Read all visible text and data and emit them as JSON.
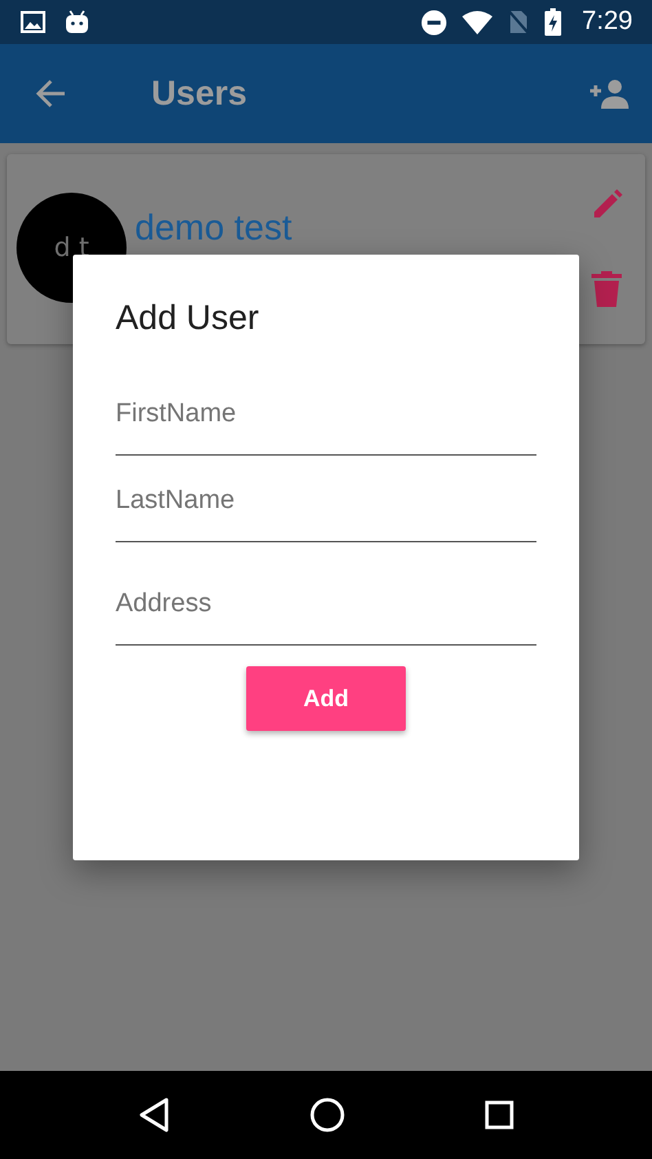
{
  "status_bar": {
    "time": "7:29"
  },
  "app_bar": {
    "title": "Users"
  },
  "users": [
    {
      "initials": "d t",
      "name": "demo test"
    }
  ],
  "dialog": {
    "title": "Add User",
    "fields": [
      {
        "placeholder": "FirstName"
      },
      {
        "placeholder": "LastName"
      },
      {
        "placeholder": "Address"
      }
    ],
    "button": "Add"
  }
}
